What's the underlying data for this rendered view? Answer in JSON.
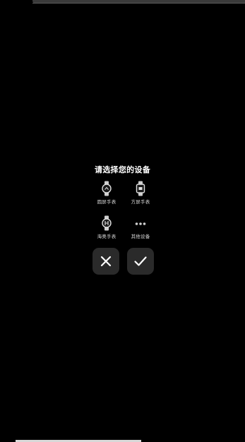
{
  "dialog": {
    "title": "请选择您的设备",
    "devices": [
      {
        "label": "圆屏手表",
        "icon": "round-watch-icon"
      },
      {
        "label": "方屏手表",
        "icon": "square-watch-icon"
      },
      {
        "label": "海奥手表",
        "icon": "h-watch-icon"
      },
      {
        "label": "其他设备",
        "icon": "more-dots-icon"
      }
    ],
    "cancel_icon": "close-icon",
    "confirm_icon": "check-icon"
  }
}
